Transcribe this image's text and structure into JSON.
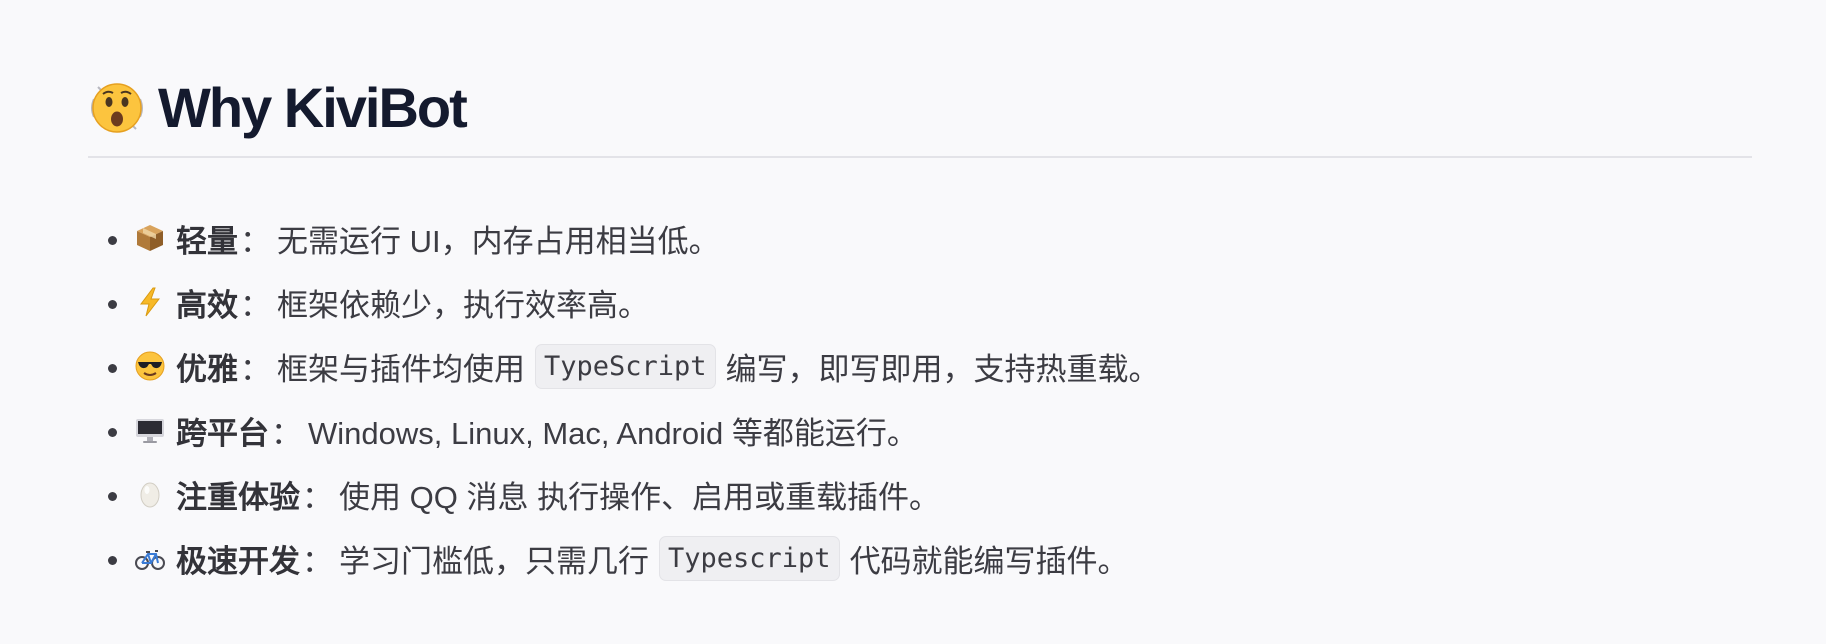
{
  "heading": {
    "emoji": "astonished-face-icon",
    "title": "Why KiviBot"
  },
  "features": [
    {
      "icon": "package-icon",
      "label": "轻量",
      "colon": "：",
      "text_before": "无需运行 UI，内存占用相当低。",
      "code": "",
      "text_after": ""
    },
    {
      "icon": "lightning-icon",
      "label": "高效",
      "colon": "：",
      "text_before": "框架依赖少，执行效率高。",
      "code": "",
      "text_after": ""
    },
    {
      "icon": "sunglasses-face-icon",
      "label": "优雅",
      "colon": "：",
      "text_before": "框架与插件均使用",
      "code": "TypeScript",
      "text_after": "编写，即写即用，支持热重载。"
    },
    {
      "icon": "desktop-computer-icon",
      "label": "跨平台",
      "colon": "：",
      "text_before": "Windows, Linux, Mac, Android 等都能运行。",
      "code": "",
      "text_after": ""
    },
    {
      "icon": "egg-icon",
      "label": "注重体验",
      "colon": "：",
      "text_before": "使用 QQ 消息 执行操作、启用或重载插件。",
      "code": "",
      "text_after": ""
    },
    {
      "icon": "bicycle-icon",
      "label": "极速开发",
      "colon": "：",
      "text_before": "学习门槛低，只需几行",
      "code": "Typescript",
      "text_after": "代码就能编写插件。"
    }
  ]
}
